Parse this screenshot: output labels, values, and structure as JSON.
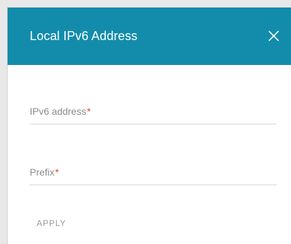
{
  "dialog": {
    "title": "Local IPv6 Address",
    "close_icon": "close-icon",
    "header_color": "#138cab"
  },
  "fields": {
    "ipv6": {
      "label": "IPv6 address",
      "required_mark": "*",
      "value": ""
    },
    "prefix": {
      "label": "Prefix",
      "required_mark": "*",
      "value": ""
    }
  },
  "actions": {
    "apply_label": "APPLY"
  },
  "colors": {
    "required": "#e8401c",
    "label": "#8a8a8a"
  }
}
